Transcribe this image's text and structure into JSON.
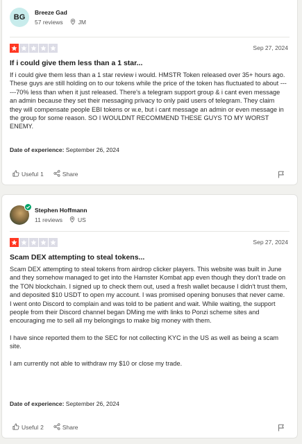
{
  "reviews": [
    {
      "reviewer": {
        "initials": "BG",
        "name": "Breeze Gad",
        "review_count": "57 reviews",
        "location": "JM"
      },
      "rating": 1,
      "date": "Sep 27, 2024",
      "title": "If i could give them less than a 1 star...",
      "paragraphs": [
        "If i could give them less than a 1 star review i would. HMSTR Token released over 35+ hours ago. These guys are still holding on to our tokens while the price of the token has fluctuated to about ------70% less than when it just released. There's a telegram support group & i cant even message an admin because they set their messaging privacy to only paid users of telegram. They claim they will compensate people EBI tokens or w.e, but i cant message an admin or even message in the group for some reason. SO I WOULDNT RECOMMEND THESE GUYS TO MY WORST ENEMY."
      ],
      "experience_label": "Date of experience:",
      "experience_date": "September 26, 2024",
      "useful_label": "Useful",
      "useful_count": "1",
      "share_label": "Share"
    },
    {
      "reviewer": {
        "initials": "",
        "name": "Stephen Hoffmann",
        "review_count": "11 reviews",
        "location": "US"
      },
      "rating": 1,
      "date": "Sep 27, 2024",
      "title": "Scam DEX attempting to steal tokens...",
      "paragraphs": [
        "Scam DEX attempting to steal tokens from airdrop clicker players. This website was built in June and they somehow managed to get into the Hamster Kombat app even though they don't trade on the TON blockchain. I signed up to check them out, used a fresh wallet because I didn't trust them, and deposited $10 USDT to open my account. I was promised opening bonuses that never came. I went onto Discord to complain and was told to be patient and wait. While waiting, the support people from their Discord channel began DMing me with links to Ponzi scheme sites and encouraging me to sell all my belongings to make big money with them.",
        "I have since reported them to the SEC for not collecting KYC in the US as well as being a scam site.",
        "I am currently not able to withdraw my $10 or close my trade."
      ],
      "experience_label": "Date of experience:",
      "experience_date": "September 26, 2024",
      "useful_label": "Useful",
      "useful_count": "2",
      "share_label": "Share"
    }
  ],
  "colors": {
    "star_on": "#ff3722",
    "star_off": "#dcdce6",
    "avatar_bg": "#c8ecec",
    "verified": "#04a369"
  },
  "icons": [
    "location-pin-icon",
    "star-icon",
    "thumbs-up-icon",
    "share-icon",
    "flag-icon",
    "verified-check-icon"
  ]
}
